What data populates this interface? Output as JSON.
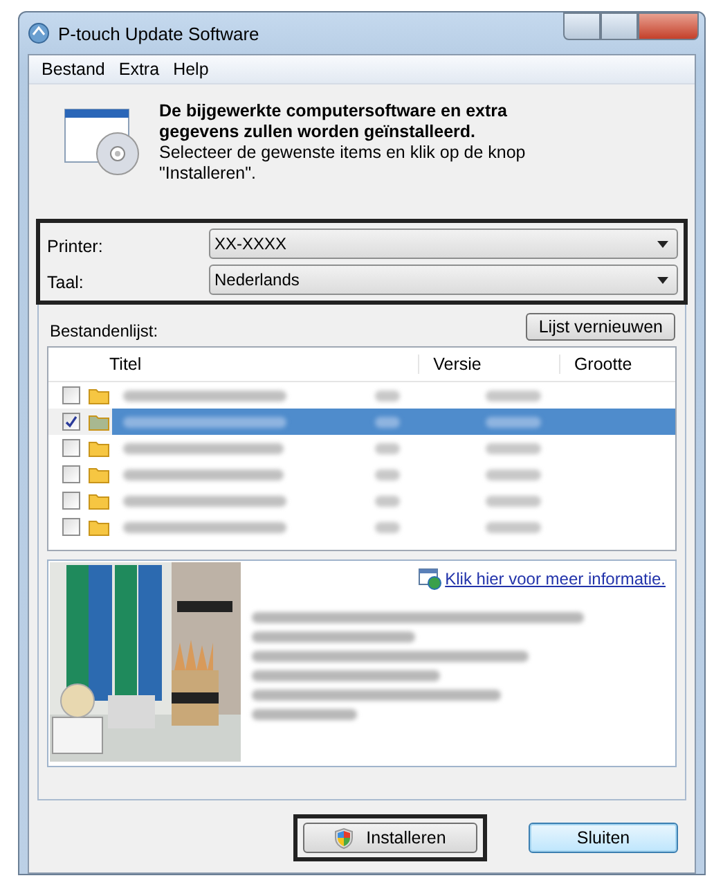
{
  "window": {
    "title": "P-touch Update Software"
  },
  "menu": [
    "Bestand",
    "Extra",
    "Help"
  ],
  "header": {
    "heading": "De bijgewerkte computersoftware en extra gegevens zullen worden geïnstalleerd.",
    "text": "Selecteer de gewenste items en klik op de knop \"Installeren\"."
  },
  "selectors": [
    {
      "label": "Printer:",
      "value": "XX-XXXX"
    },
    {
      "label": "Taal:",
      "value": "Nederlands"
    }
  ],
  "file_list": {
    "label": "Bestandenlijst:",
    "refresh_button": "Lijst vernieuwen",
    "columns": [
      "Titel",
      "Versie",
      "Grootte"
    ],
    "rows": [
      {
        "checked": false,
        "selected": false
      },
      {
        "checked": true,
        "selected": true
      },
      {
        "checked": false,
        "selected": false
      },
      {
        "checked": false,
        "selected": false
      },
      {
        "checked": false,
        "selected": false
      },
      {
        "checked": false,
        "selected": false
      }
    ]
  },
  "info": {
    "kind": "picture",
    "link": "Klik hier voor meer informatie."
  },
  "buttons": [
    {
      "label": "Installeren",
      "highlighted": true,
      "shield": true
    },
    {
      "label": "Sluiten",
      "highlighted": false,
      "shield": false
    }
  ]
}
